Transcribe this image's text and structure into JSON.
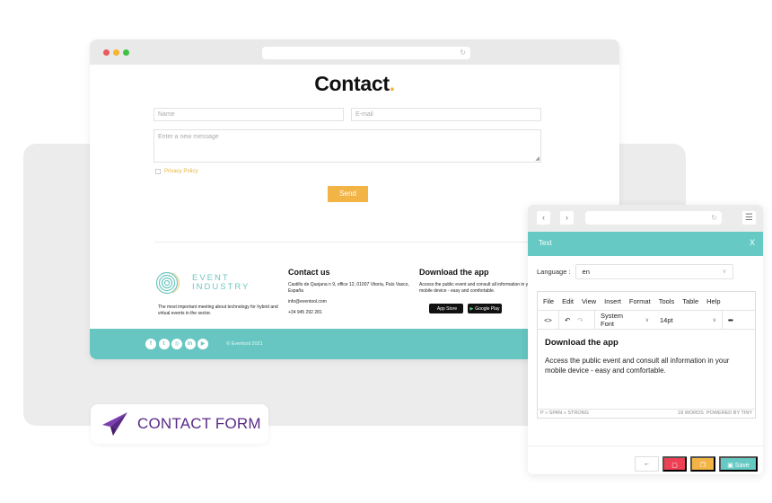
{
  "site": {
    "page_title": "Contact",
    "page_title_accent": ".",
    "form": {
      "name_placeholder": "Name",
      "email_placeholder": "E-mail",
      "message_placeholder": "Enter a new message",
      "privacy_label": "Privacy Policy",
      "send_label": "Send"
    },
    "footer": {
      "logo_line1": "EVENT",
      "logo_line2": "INDUSTRY",
      "tagline": "The most important meeting about technology for hybrid and virtual events in the sector.",
      "contact_heading": "Contact us",
      "address": "Castillo de Quejana n 9, office 12, 01007 Vitoria, País Vasco, España",
      "email": "info@eventool.com",
      "phone": "+34 945 292 281",
      "app_heading": "Download the app",
      "app_text": "Access the public event and consult all information in your mobile device - easy and comfortable.",
      "app_store_label": "App Store",
      "google_play_label": "Google Play",
      "socials": [
        {
          "name": "facebook",
          "glyph": "f"
        },
        {
          "name": "twitter",
          "glyph": "t"
        },
        {
          "name": "instagram",
          "glyph": "◎"
        },
        {
          "name": "linkedin",
          "glyph": "in"
        },
        {
          "name": "youtube",
          "glyph": "▶"
        }
      ],
      "copyright": "© Eventool 2021"
    }
  },
  "badge": {
    "label": "CONTACT FORM",
    "icon": "paper-plane-icon",
    "color": "#5b2a86"
  },
  "editor": {
    "panel_title": "Text",
    "close_glyph": "X",
    "language_label": "Language :",
    "language_value": "en",
    "menu": [
      "File",
      "Edit",
      "View",
      "Insert",
      "Format",
      "Tools",
      "Table",
      "Help"
    ],
    "toolbar": {
      "code_glyph": "<>",
      "undo_glyph": "↶",
      "redo_glyph": "↷",
      "font_family": "System Font",
      "font_size": "14pt",
      "more_glyph": "•••"
    },
    "content": {
      "heading": "Download the app",
      "paragraph": "Access the public event and consult all information in your mobile device - easy and comfortable."
    },
    "status": {
      "path": "P » SPAN » STRONG",
      "word_count": "18 WORDS",
      "powered_by": "POWERED BY TINY"
    },
    "actions": {
      "back_glyph": "←",
      "delete_glyph": "🗑",
      "duplicate_glyph": "❐",
      "save_label": "Save"
    },
    "accent_color": "#66c9c3"
  },
  "colors": {
    "teal": "#67c6c1",
    "yellow": "#f2b445",
    "red": "#ee3f55"
  }
}
